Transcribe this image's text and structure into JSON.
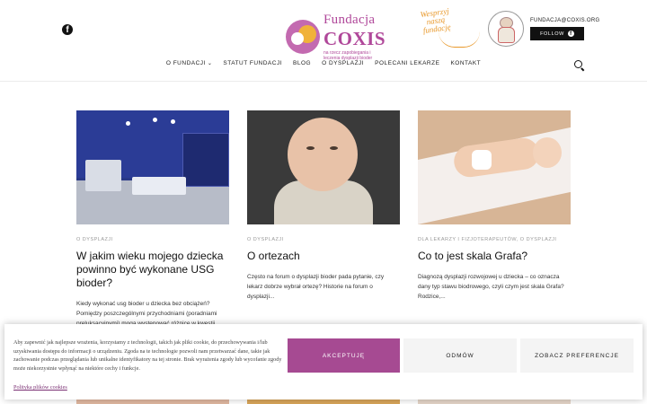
{
  "header": {
    "logo": {
      "line1": "Fundacja",
      "line2": "COXIS",
      "tagline": "na rzecz zapobiegania i leczenia dysplazji bioder"
    },
    "support_text": "Wesprzyj naszą fundację",
    "email": "FUNDACJA@COXIS.ORG",
    "follow_label": "FOLLOW",
    "social_icon": "facebook-icon"
  },
  "nav": {
    "items": [
      {
        "label": "O FUNDACJI",
        "has_dropdown": true
      },
      {
        "label": "STATUT FUNDACJI"
      },
      {
        "label": "BLOG"
      },
      {
        "label": "O DYSPLAZJI"
      },
      {
        "label": "POLECANI LEKARZE"
      },
      {
        "label": "KONTAKT"
      }
    ]
  },
  "posts": [
    {
      "category": "O DYSPLAZJI",
      "title": "W jakim wieku mojego dziecka powinno być wykonane USG bioder?",
      "excerpt": "Kiedy wykonać usg bioder u dziecka bez obciążeń? Pomiędzy poszczególnymi przychodniami (poradniami preluksacyjnymi) mogą występować różnice w kwestii..."
    },
    {
      "category": "O DYSPLAZJI",
      "title": "O ortezach",
      "excerpt": "Często na forum o dysplazji bioder pada pytanie, czy lekarz dobrze wybrał ortezę? Historie na forum o dysplazji..."
    },
    {
      "category": "DLA LEKARZY I FIZJOTERAPEUTÓW, O DYSPLAZJI",
      "title": "Co to jest skala Grafa?",
      "excerpt": "Diagnozą dysplazji rozwojowej u dziecka – co oznacza dany typ stawu biodrowego, czyli czym jest skala Grafa? Rodzice,..."
    }
  ],
  "cookie": {
    "text": "Aby zapewnić jak najlepsze wrażenia, korzystamy z technologii, takich jak pliki cookie, do przechowywania i/lub uzyskiwania dostępu do informacji o urządzeniu. Zgoda na te technologie pozwoli nam przetwarzać dane, takie jak zachowanie podczas przeglądania lub unikalne identyfikatory na tej stronie. Brak wyrażenia zgody lub wycofanie zgody może niekorzystnie wpłynąć na niektóre cechy i funkcje.",
    "policy_link": "Polityka plików cookies",
    "accept": "AKCEPTUJĘ",
    "deny": "ODMÓW",
    "prefs": "ZOBACZ PREFERENCJE"
  },
  "colors": {
    "brand": "#a64a92",
    "accent": "#e8982a"
  }
}
